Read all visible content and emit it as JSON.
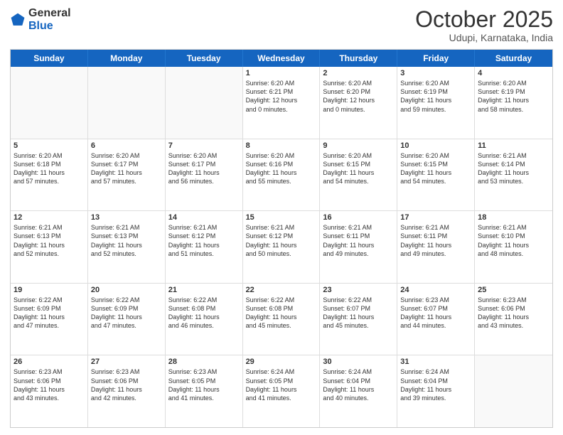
{
  "logo": {
    "general": "General",
    "blue": "Blue"
  },
  "header": {
    "month": "October 2025",
    "location": "Udupi, Karnataka, India"
  },
  "days": [
    "Sunday",
    "Monday",
    "Tuesday",
    "Wednesday",
    "Thursday",
    "Friday",
    "Saturday"
  ],
  "rows": [
    [
      {
        "num": "",
        "lines": []
      },
      {
        "num": "",
        "lines": []
      },
      {
        "num": "",
        "lines": []
      },
      {
        "num": "1",
        "lines": [
          "Sunrise: 6:20 AM",
          "Sunset: 6:21 PM",
          "Daylight: 12 hours",
          "and 0 minutes."
        ]
      },
      {
        "num": "2",
        "lines": [
          "Sunrise: 6:20 AM",
          "Sunset: 6:20 PM",
          "Daylight: 12 hours",
          "and 0 minutes."
        ]
      },
      {
        "num": "3",
        "lines": [
          "Sunrise: 6:20 AM",
          "Sunset: 6:19 PM",
          "Daylight: 11 hours",
          "and 59 minutes."
        ]
      },
      {
        "num": "4",
        "lines": [
          "Sunrise: 6:20 AM",
          "Sunset: 6:19 PM",
          "Daylight: 11 hours",
          "and 58 minutes."
        ]
      }
    ],
    [
      {
        "num": "5",
        "lines": [
          "Sunrise: 6:20 AM",
          "Sunset: 6:18 PM",
          "Daylight: 11 hours",
          "and 57 minutes."
        ]
      },
      {
        "num": "6",
        "lines": [
          "Sunrise: 6:20 AM",
          "Sunset: 6:17 PM",
          "Daylight: 11 hours",
          "and 57 minutes."
        ]
      },
      {
        "num": "7",
        "lines": [
          "Sunrise: 6:20 AM",
          "Sunset: 6:17 PM",
          "Daylight: 11 hours",
          "and 56 minutes."
        ]
      },
      {
        "num": "8",
        "lines": [
          "Sunrise: 6:20 AM",
          "Sunset: 6:16 PM",
          "Daylight: 11 hours",
          "and 55 minutes."
        ]
      },
      {
        "num": "9",
        "lines": [
          "Sunrise: 6:20 AM",
          "Sunset: 6:15 PM",
          "Daylight: 11 hours",
          "and 54 minutes."
        ]
      },
      {
        "num": "10",
        "lines": [
          "Sunrise: 6:20 AM",
          "Sunset: 6:15 PM",
          "Daylight: 11 hours",
          "and 54 minutes."
        ]
      },
      {
        "num": "11",
        "lines": [
          "Sunrise: 6:21 AM",
          "Sunset: 6:14 PM",
          "Daylight: 11 hours",
          "and 53 minutes."
        ]
      }
    ],
    [
      {
        "num": "12",
        "lines": [
          "Sunrise: 6:21 AM",
          "Sunset: 6:13 PM",
          "Daylight: 11 hours",
          "and 52 minutes."
        ]
      },
      {
        "num": "13",
        "lines": [
          "Sunrise: 6:21 AM",
          "Sunset: 6:13 PM",
          "Daylight: 11 hours",
          "and 52 minutes."
        ]
      },
      {
        "num": "14",
        "lines": [
          "Sunrise: 6:21 AM",
          "Sunset: 6:12 PM",
          "Daylight: 11 hours",
          "and 51 minutes."
        ]
      },
      {
        "num": "15",
        "lines": [
          "Sunrise: 6:21 AM",
          "Sunset: 6:12 PM",
          "Daylight: 11 hours",
          "and 50 minutes."
        ]
      },
      {
        "num": "16",
        "lines": [
          "Sunrise: 6:21 AM",
          "Sunset: 6:11 PM",
          "Daylight: 11 hours",
          "and 49 minutes."
        ]
      },
      {
        "num": "17",
        "lines": [
          "Sunrise: 6:21 AM",
          "Sunset: 6:11 PM",
          "Daylight: 11 hours",
          "and 49 minutes."
        ]
      },
      {
        "num": "18",
        "lines": [
          "Sunrise: 6:21 AM",
          "Sunset: 6:10 PM",
          "Daylight: 11 hours",
          "and 48 minutes."
        ]
      }
    ],
    [
      {
        "num": "19",
        "lines": [
          "Sunrise: 6:22 AM",
          "Sunset: 6:09 PM",
          "Daylight: 11 hours",
          "and 47 minutes."
        ]
      },
      {
        "num": "20",
        "lines": [
          "Sunrise: 6:22 AM",
          "Sunset: 6:09 PM",
          "Daylight: 11 hours",
          "and 47 minutes."
        ]
      },
      {
        "num": "21",
        "lines": [
          "Sunrise: 6:22 AM",
          "Sunset: 6:08 PM",
          "Daylight: 11 hours",
          "and 46 minutes."
        ]
      },
      {
        "num": "22",
        "lines": [
          "Sunrise: 6:22 AM",
          "Sunset: 6:08 PM",
          "Daylight: 11 hours",
          "and 45 minutes."
        ]
      },
      {
        "num": "23",
        "lines": [
          "Sunrise: 6:22 AM",
          "Sunset: 6:07 PM",
          "Daylight: 11 hours",
          "and 45 minutes."
        ]
      },
      {
        "num": "24",
        "lines": [
          "Sunrise: 6:23 AM",
          "Sunset: 6:07 PM",
          "Daylight: 11 hours",
          "and 44 minutes."
        ]
      },
      {
        "num": "25",
        "lines": [
          "Sunrise: 6:23 AM",
          "Sunset: 6:06 PM",
          "Daylight: 11 hours",
          "and 43 minutes."
        ]
      }
    ],
    [
      {
        "num": "26",
        "lines": [
          "Sunrise: 6:23 AM",
          "Sunset: 6:06 PM",
          "Daylight: 11 hours",
          "and 43 minutes."
        ]
      },
      {
        "num": "27",
        "lines": [
          "Sunrise: 6:23 AM",
          "Sunset: 6:06 PM",
          "Daylight: 11 hours",
          "and 42 minutes."
        ]
      },
      {
        "num": "28",
        "lines": [
          "Sunrise: 6:23 AM",
          "Sunset: 6:05 PM",
          "Daylight: 11 hours",
          "and 41 minutes."
        ]
      },
      {
        "num": "29",
        "lines": [
          "Sunrise: 6:24 AM",
          "Sunset: 6:05 PM",
          "Daylight: 11 hours",
          "and 41 minutes."
        ]
      },
      {
        "num": "30",
        "lines": [
          "Sunrise: 6:24 AM",
          "Sunset: 6:04 PM",
          "Daylight: 11 hours",
          "and 40 minutes."
        ]
      },
      {
        "num": "31",
        "lines": [
          "Sunrise: 6:24 AM",
          "Sunset: 6:04 PM",
          "Daylight: 11 hours",
          "and 39 minutes."
        ]
      },
      {
        "num": "",
        "lines": []
      }
    ]
  ]
}
